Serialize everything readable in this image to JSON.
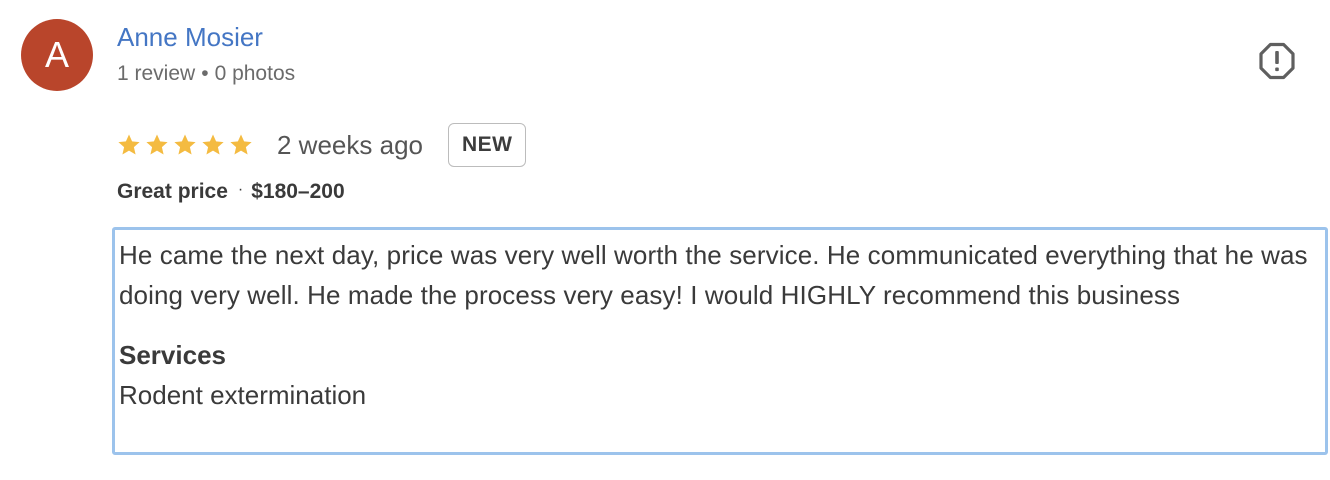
{
  "author": {
    "avatar_letter": "A",
    "avatar_color": "#b9452b",
    "name": "Anne Mosier",
    "reviews_count": "1 review",
    "meta_separator": "•",
    "photos_count": "0 photos"
  },
  "actions": {
    "flag_icon": "report-flag-icon"
  },
  "review": {
    "rating": 5,
    "rating_max": 5,
    "star_color": "#f4bb41",
    "date": "2 weeks ago",
    "badge": "NEW",
    "price_label": "Great price",
    "price_separator": "·",
    "price_range": "$180–200",
    "text": "He came the next day, price was very well worth the service. He communicated everything that he was doing very well. He made the process very easy! I would HIGHLY recommend this business",
    "services_title": "Services",
    "services_value": "Rodent extermination"
  },
  "colors": {
    "link": "#4476c4",
    "focus_border": "#9cc3ec"
  }
}
